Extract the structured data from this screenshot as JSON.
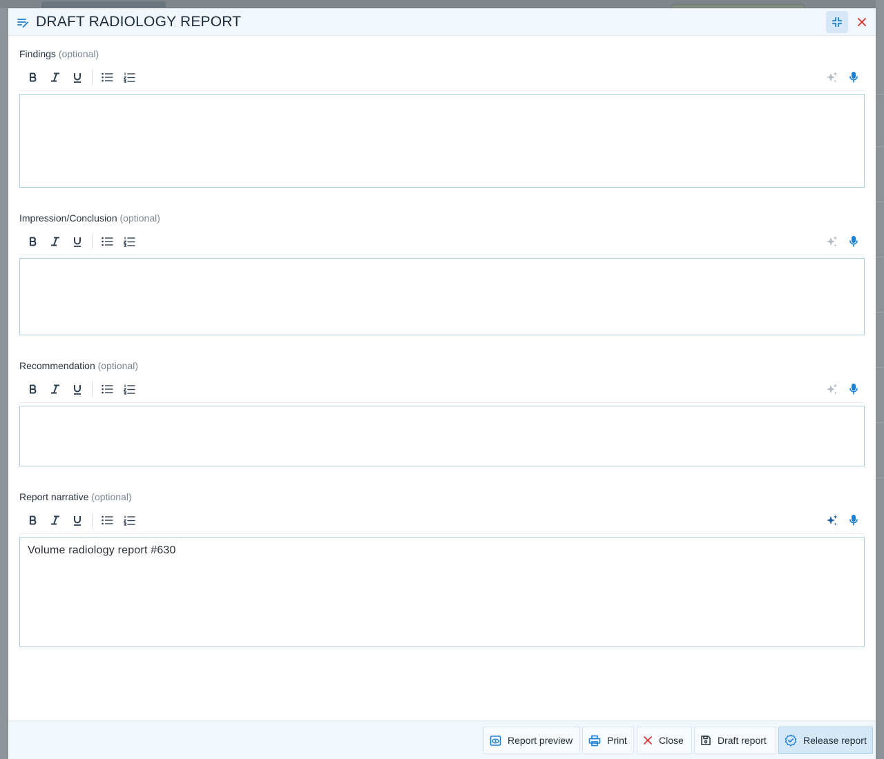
{
  "modal": {
    "title": "DRAFT RADIOLOGY REPORT"
  },
  "sections": [
    {
      "label": "Findings",
      "optional": "(optional)",
      "value": ""
    },
    {
      "label": "Impression/Conclusion",
      "optional": "(optional)",
      "value": ""
    },
    {
      "label": "Recommendation",
      "optional": "(optional)",
      "value": ""
    },
    {
      "label": "Report narrative",
      "optional": "(optional)",
      "value": "Volume radiology report #630"
    }
  ],
  "toolbar": {
    "icons": [
      "bold-icon",
      "italic-icon",
      "underline-icon",
      "bullet-list-icon",
      "numbered-list-icon",
      "ai-sparkle-icon",
      "microphone-icon"
    ]
  },
  "footer": {
    "report_preview": "Report preview",
    "print": "Print",
    "close": "Close",
    "draft_report": "Draft report",
    "release_report": "Release report"
  },
  "colors": {
    "accent": "#1a7fd4",
    "close_red": "#d32f2f",
    "editor_border": "#a9cde0",
    "header_bg": "#f1f7fc"
  }
}
